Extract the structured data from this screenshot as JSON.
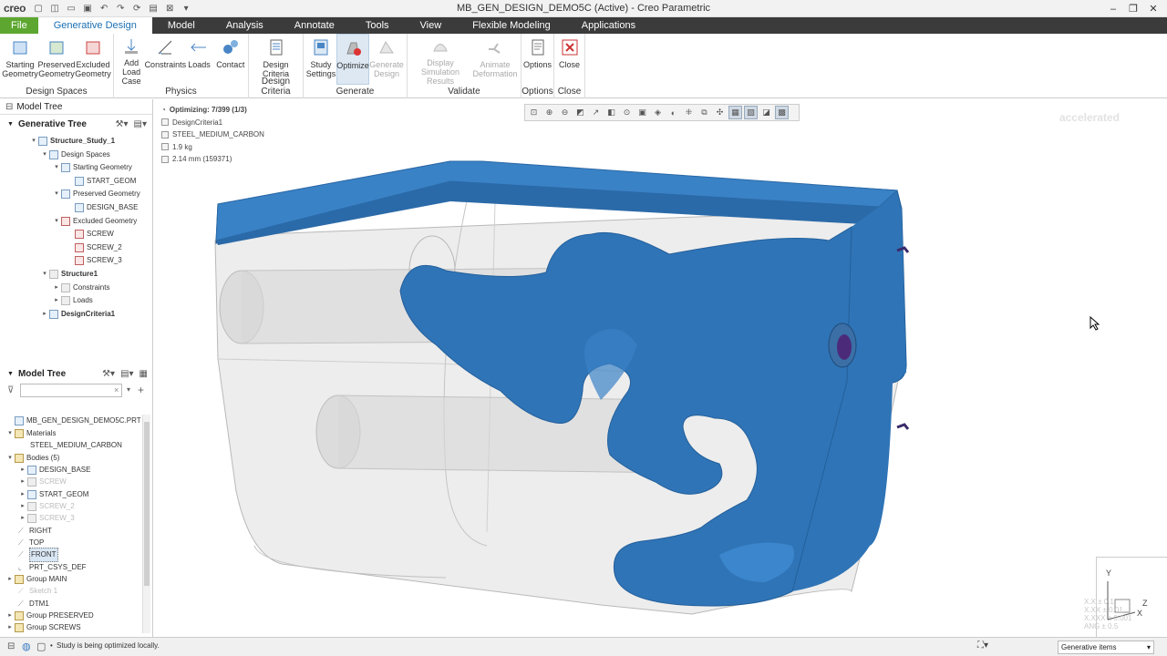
{
  "titlebar": {
    "logo": "creo",
    "title": "MB_GEN_DESIGN_DEMO5C (Active) - Creo Parametric"
  },
  "tabs": [
    "File",
    "Generative Design",
    "Model",
    "Analysis",
    "Annotate",
    "Tools",
    "View",
    "Flexible Modeling",
    "Applications"
  ],
  "ribbon": {
    "design_spaces": {
      "label": "Design Spaces",
      "buttons": [
        "Starting\nGeometry",
        "Preserved\nGeometry",
        "Excluded\nGeometry"
      ]
    },
    "physics": {
      "label": "Physics",
      "buttons": [
        "Add Load\nCase",
        "Constraints",
        "Loads",
        "Contact"
      ]
    },
    "design_criteria": {
      "label": "Design Criteria",
      "buttons": [
        "Design\nCriteria"
      ]
    },
    "generate": {
      "label": "Generate",
      "buttons": [
        "Study\nSettings",
        "Optimize",
        "Generate\nDesign"
      ]
    },
    "validate": {
      "label": "Validate",
      "buttons": [
        "Display\nSimulation Results",
        "Animate\nDeformation"
      ]
    },
    "options": {
      "label": "Options",
      "buttons": [
        "Options"
      ]
    },
    "close": {
      "label": "Close",
      "buttons": [
        "Close"
      ]
    }
  },
  "left_panel": {
    "tab_label": "Model Tree",
    "generative_tree": {
      "header": "Generative Tree",
      "items": [
        "Structure_Study_1",
        "Design Spaces",
        "Starting Geometry",
        "START_GEOM",
        "Preserved Geometry",
        "DESIGN_BASE",
        "Excluded Geometry",
        "SCREW",
        "SCREW_2",
        "SCREW_3",
        "Structure1",
        "Constraints",
        "Loads",
        "DesignCriteria1"
      ]
    },
    "model_tree": {
      "header": "Model Tree",
      "items": [
        "MB_GEN_DESIGN_DEMO5C.PRT",
        "Materials",
        "STEEL_MEDIUM_CARBON",
        "Bodies (5)",
        "DESIGN_BASE",
        "SCREW",
        "START_GEOM",
        "SCREW_2",
        "SCREW_3",
        "RIGHT",
        "TOP",
        "FRONT",
        "PRT_CSYS_DEF",
        "Group MAIN",
        "Sketch 1",
        "DTM1",
        "Group PRESERVED",
        "Group SCREWS"
      ]
    }
  },
  "graphics": {
    "info": [
      "Optimizing: 7/399 (1/3)",
      "DesignCriteria1",
      "STEEL_MEDIUM_CARBON",
      "1.9 kg",
      "2.14 mm (159371)"
    ],
    "watermark": "accelerated",
    "triad_labels": [
      "Y",
      "X",
      "Z"
    ],
    "tolerance_text": [
      "X.X ± 0.1",
      "X.XX ± 0.01",
      "X.XXX ± 0.001",
      "ANG ± 0.5"
    ]
  },
  "statusbar": {
    "message": "Study is being optimized locally.",
    "filter": "Generative items"
  },
  "colors": {
    "accent": "#1a6fb3",
    "file_tab": "#5da730",
    "tab_bar": "#3b3b3b",
    "part_blue": "#2f74b6"
  }
}
